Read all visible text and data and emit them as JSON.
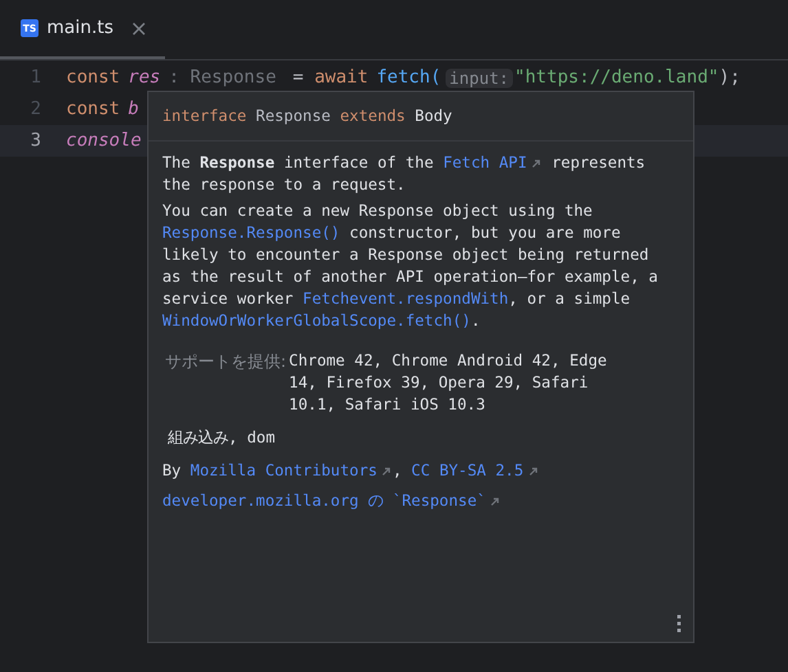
{
  "tabs": [
    {
      "label": "main.ts",
      "icon": "TS",
      "selected": true
    }
  ],
  "lines": [
    {
      "number": "1",
      "current": false,
      "tokens": [
        {
          "kind": "keyword",
          "text": "const"
        },
        {
          "kind": "variable",
          "text": "res"
        },
        {
          "kind": "type-hint",
          "text": ": Response"
        },
        {
          "kind": "plain",
          "text": "= "
        },
        {
          "kind": "keyword",
          "text": "await"
        },
        {
          "kind": "function",
          "text": "fetch("
        },
        {
          "kind": "param-hint",
          "text": "input:"
        },
        {
          "kind": "string",
          "text": "\"https://deno.land\""
        },
        {
          "kind": "plain",
          "text": ");"
        }
      ]
    },
    {
      "number": "2",
      "current": false,
      "tokens": [
        {
          "kind": "keyword",
          "text": "const"
        },
        {
          "kind": "variable",
          "text": "b"
        }
      ]
    },
    {
      "number": "3",
      "current": true,
      "tokens": [
        {
          "kind": "variable",
          "text": "console"
        }
      ]
    }
  ],
  "popup": {
    "header": [
      {
        "kind": "keyword",
        "text": "interface"
      },
      {
        "kind": "type",
        "text": "Response"
      },
      {
        "kind": "keyword",
        "text": "extends"
      },
      {
        "kind": "name",
        "text": "Body"
      }
    ],
    "paragraphs": [
      [
        {
          "kind": "text",
          "text": "The "
        },
        {
          "kind": "bold",
          "text": "Response"
        },
        {
          "kind": "text",
          "text": " interface of the "
        },
        {
          "kind": "link",
          "text": "Fetch API",
          "external": true
        },
        {
          "kind": "text",
          "text": " represents the response to a request."
        }
      ],
      [
        {
          "kind": "text",
          "text": "You can create a new Response object using the "
        },
        {
          "kind": "link",
          "text": "Response.Response()",
          "external": false
        },
        {
          "kind": "text",
          "text": " constructor, but you are more likely to encounter a Response object being returned as the result of another API operation—for example, a service worker "
        },
        {
          "kind": "link",
          "text": "Fetchevent.respondWith",
          "external": false
        },
        {
          "kind": "text",
          "text": ", or a simple "
        },
        {
          "kind": "link",
          "text": "WindowOrWorkerGlobalScope.fetch()",
          "external": false
        },
        {
          "kind": "text",
          "text": "."
        }
      ]
    ],
    "support_label": "サポートを提供:",
    "support_value": "Chrome 42, Chrome Android 42, Edge 14, Firefox 39, Opera 29, Safari 10.1, Safari iOS 10.3",
    "builtin": "組み込み, dom",
    "attribution": [
      {
        "kind": "text",
        "text": "By "
      },
      {
        "kind": "link",
        "text": "Mozilla Contributors",
        "external": true
      },
      {
        "kind": "text",
        "text": ", "
      },
      {
        "kind": "link",
        "text": "CC BY-SA 2.5",
        "external": true
      }
    ],
    "source": {
      "text": "developer.mozilla.org の `Response`",
      "external": true
    }
  }
}
